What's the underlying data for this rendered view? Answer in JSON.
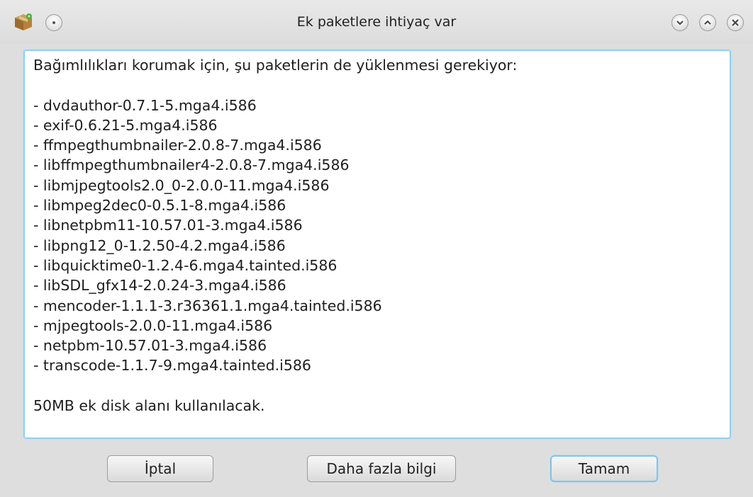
{
  "window": {
    "title": "Ek paketlere ihtiyaç var"
  },
  "icons": {
    "app": "package-icon",
    "menu": "window-menu-icon",
    "minimize": "minimize-icon",
    "maximize": "maximize-icon",
    "close": "close-icon"
  },
  "message": {
    "intro": "Bağımlılıkları korumak için, şu paketlerin de yüklenmesi gerekiyor:",
    "packages": [
      "- dvdauthor-0.7.1-5.mga4.i586",
      "- exif-0.6.21-5.mga4.i586",
      "- ffmpegthumbnailer-2.0.8-7.mga4.i586",
      "- libffmpegthumbnailer4-2.0.8-7.mga4.i586",
      "- libmjpegtools2.0_0-2.0.0-11.mga4.i586",
      "- libmpeg2dec0-0.5.1-8.mga4.i586",
      "- libnetpbm11-10.57.01-3.mga4.i586",
      "- libpng12_0-1.2.50-4.2.mga4.i586",
      "- libquicktime0-1.2.4-6.mga4.tainted.i586",
      "- libSDL_gfx14-2.0.24-3.mga4.i586",
      "- mencoder-1.1.1-3.r36361.1.mga4.tainted.i586",
      "- mjpegtools-2.0.0-11.mga4.i586",
      "- netpbm-10.57.01-3.mga4.i586",
      "- transcode-1.1.7-9.mga4.tainted.i586"
    ],
    "summary": "50MB ek disk alanı kullanılacak."
  },
  "buttons": {
    "cancel": "İptal",
    "more_info": "Daha fazla bilgi",
    "ok": "Tamam"
  },
  "colors": {
    "focus_border": "#8fd0f0",
    "window_bg": "#dedede"
  }
}
